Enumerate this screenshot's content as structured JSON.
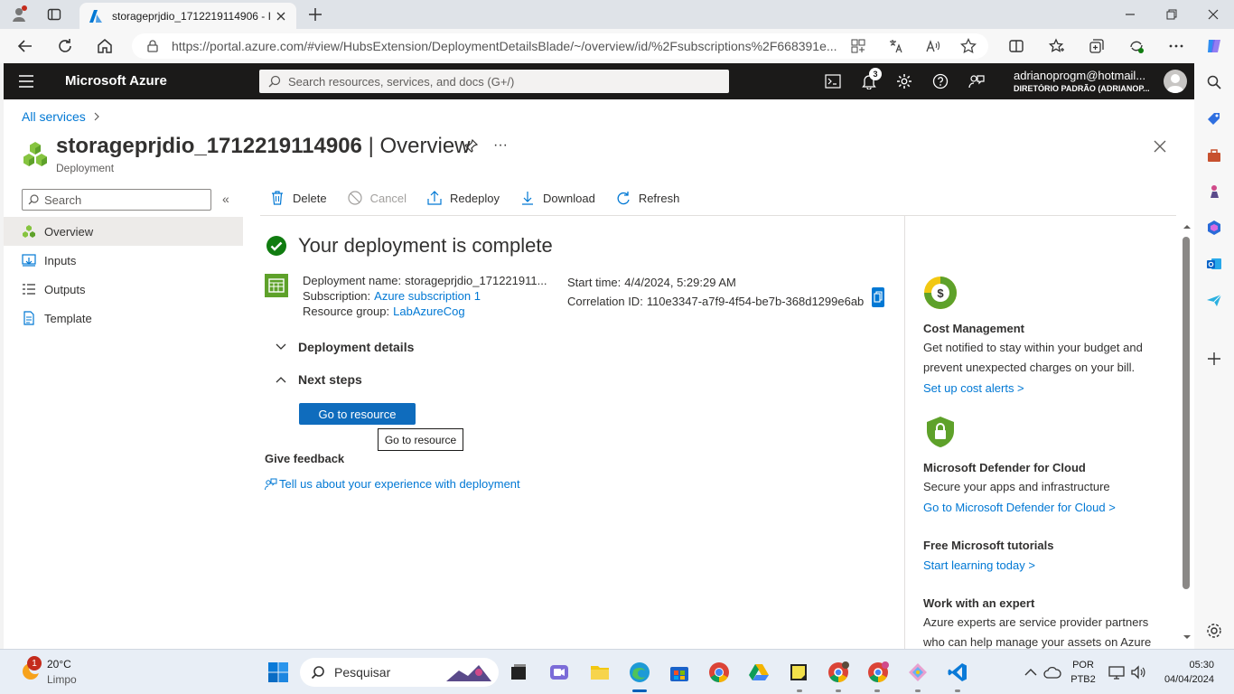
{
  "browser": {
    "tab_title": "storageprjdio_1712219114906 - I",
    "url": "https://portal.azure.com/#view/HubsExtension/DeploymentDetailsBlade/~/overview/id/%2Fsubscriptions%2F668391e..."
  },
  "azure": {
    "brand": "Microsoft Azure",
    "search_placeholder": "Search resources, services, and docs (G+/)",
    "notifications_count": "3",
    "user_email": "adrianoprogm@hotmail...",
    "user_directory": "DIRETÓRIO PADRÃO (ADRIANOP..."
  },
  "page": {
    "breadcrumb": "All services",
    "title_bold": "storageprjdio_1712219114906",
    "title_rest": " | Overview",
    "subtitle": "Deployment",
    "more": "···"
  },
  "sidebar": {
    "search_placeholder": "Search",
    "collapse": "«",
    "items": [
      {
        "label": "Overview",
        "icon": "overview-icon"
      },
      {
        "label": "Inputs",
        "icon": "inputs-icon"
      },
      {
        "label": "Outputs",
        "icon": "outputs-icon"
      },
      {
        "label": "Template",
        "icon": "template-icon"
      }
    ]
  },
  "commands": {
    "delete": "Delete",
    "cancel": "Cancel",
    "redeploy": "Redeploy",
    "download": "Download",
    "refresh": "Refresh"
  },
  "deployment": {
    "status": "Your deployment is complete",
    "name_label": "Deployment name:",
    "name_value": "storageprjdio_171221911...",
    "subscription_label": "Subscription:",
    "subscription_value": "Azure subscription 1",
    "rg_label": "Resource group:",
    "rg_value": "LabAzureCog",
    "start_label": "Start time:",
    "start_value": "4/4/2024, 5:29:29 AM",
    "corr_label": "Correlation ID:",
    "corr_value": "110e3347-a7f9-4f54-be7b-368d1299e6ab",
    "details_header": "Deployment details",
    "next_header": "Next steps",
    "go_button": "Go to resource",
    "tooltip": "Go to resource",
    "feedback_title": "Give feedback",
    "feedback_link": "Tell us about your experience with deployment"
  },
  "right_panel": {
    "cost_title": "Cost Management",
    "cost_text": "Get notified to stay within your budget and prevent unexpected charges on your bill.",
    "cost_link": "Set up cost alerts >",
    "defender_title": "Microsoft Defender for Cloud",
    "defender_text": "Secure your apps and infrastructure",
    "defender_link": "Go to Microsoft Defender for Cloud >",
    "tutorials_title": "Free Microsoft tutorials",
    "tutorials_link": "Start learning today >",
    "expert_title": "Work with an expert",
    "expert_text": "Azure experts are service provider partners who can help manage your assets on Azure"
  },
  "taskbar": {
    "weather_temp": "20°C",
    "weather_desc": "Limpo",
    "weather_badge": "1",
    "search": "Pesquisar",
    "lang1": "POR",
    "lang2": "PTB2",
    "time": "05:30",
    "date": "04/04/2024"
  },
  "colors": {
    "azure_blue": "#0078d4",
    "topbar": "#1b1a19",
    "success": "#107c10"
  }
}
